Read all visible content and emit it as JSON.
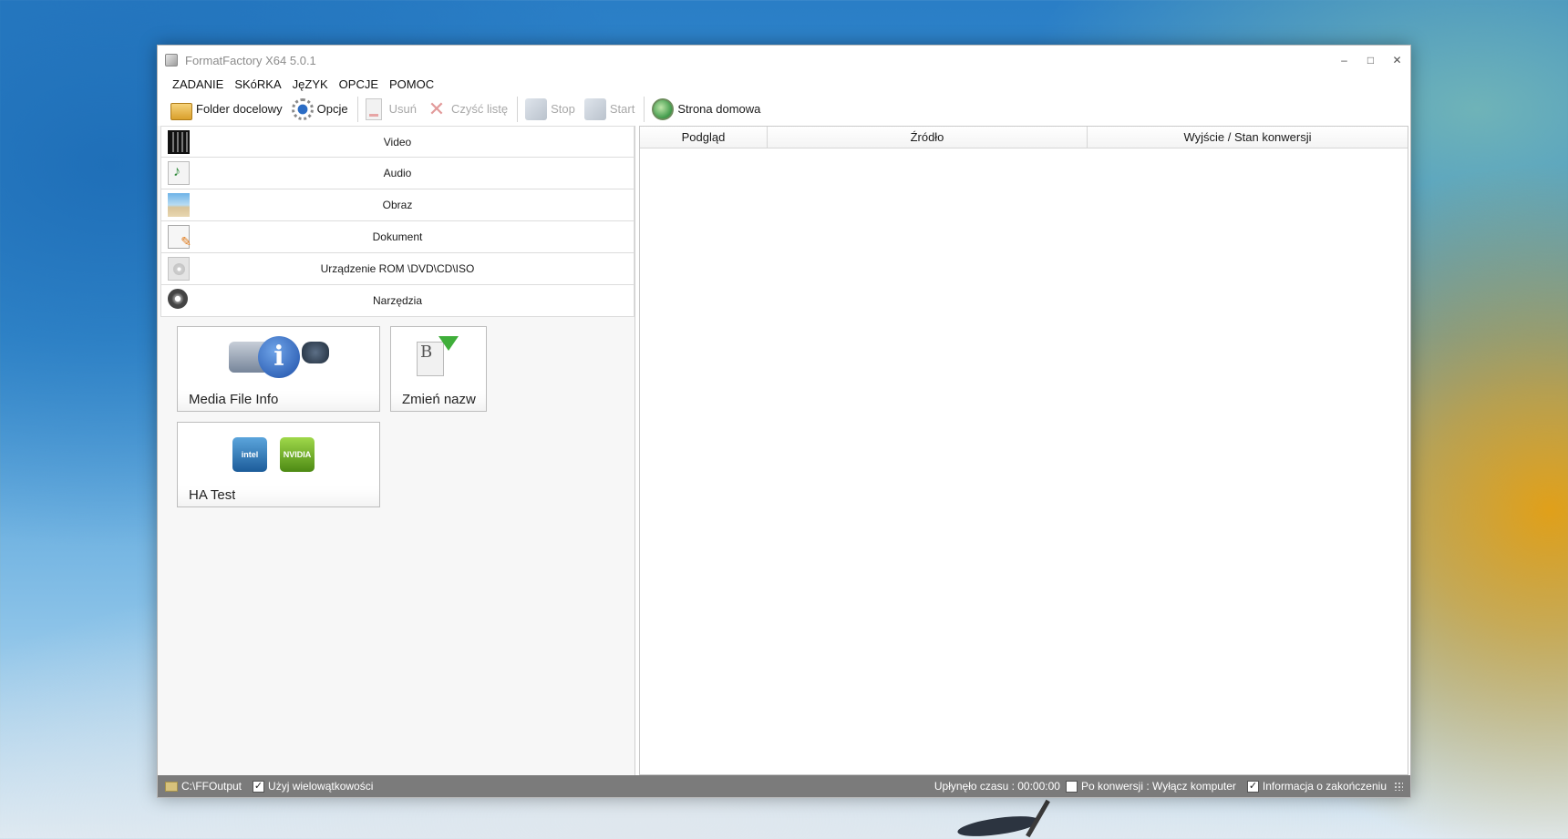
{
  "window": {
    "title": "FormatFactory X64 5.0.1",
    "controls": [
      "–",
      "□",
      "✕"
    ]
  },
  "menu": [
    "ZADANIE",
    "SKóRKA",
    "JęZYK",
    "OPCJE",
    "POMOC"
  ],
  "toolbar": {
    "folder": "Folder docelowy",
    "opcje": "Opcje",
    "usun": "Usuń",
    "czysc": "Czyść listę",
    "stop": "Stop",
    "start": "Start",
    "home": "Strona domowa"
  },
  "categories": [
    {
      "label": "Video",
      "icon": "film-icon"
    },
    {
      "label": "Audio",
      "icon": "music-note-icon"
    },
    {
      "label": "Obraz",
      "icon": "picture-icon"
    },
    {
      "label": "Dokument",
      "icon": "document-icon"
    },
    {
      "label": "Urządzenie ROM \\DVD\\CD\\ISO",
      "icon": "disc-icon"
    },
    {
      "label": "Narzędzia",
      "icon": "tools-reel-icon"
    }
  ],
  "tools": [
    {
      "label": "Media File Info",
      "icon": "media-info-icon"
    },
    {
      "label": "Zmień nazw",
      "icon": "rename-icon"
    },
    {
      "label": "HA Test",
      "icon": "hardware-acceleration-icon",
      "chips": [
        "intel",
        "NVIDIA"
      ]
    }
  ],
  "table": {
    "columns": [
      "Podgląd",
      "Źródło",
      "Wyjście / Stan konwersji"
    ]
  },
  "status": {
    "output_path": "C:\\FFOutput",
    "multithread": "Użyj wielowątkowości",
    "multithread_checked": true,
    "elapsed": "Upłynęło czasu : 00:00:00",
    "after_conversion": "Po konwersji : Wyłącz komputer",
    "after_conversion_checked": false,
    "notify": "Informacja o zakończeniu",
    "notify_checked": true
  },
  "colors": {
    "statusbar": "#7b7b7b",
    "disabled_text": "#a8a8a8"
  }
}
